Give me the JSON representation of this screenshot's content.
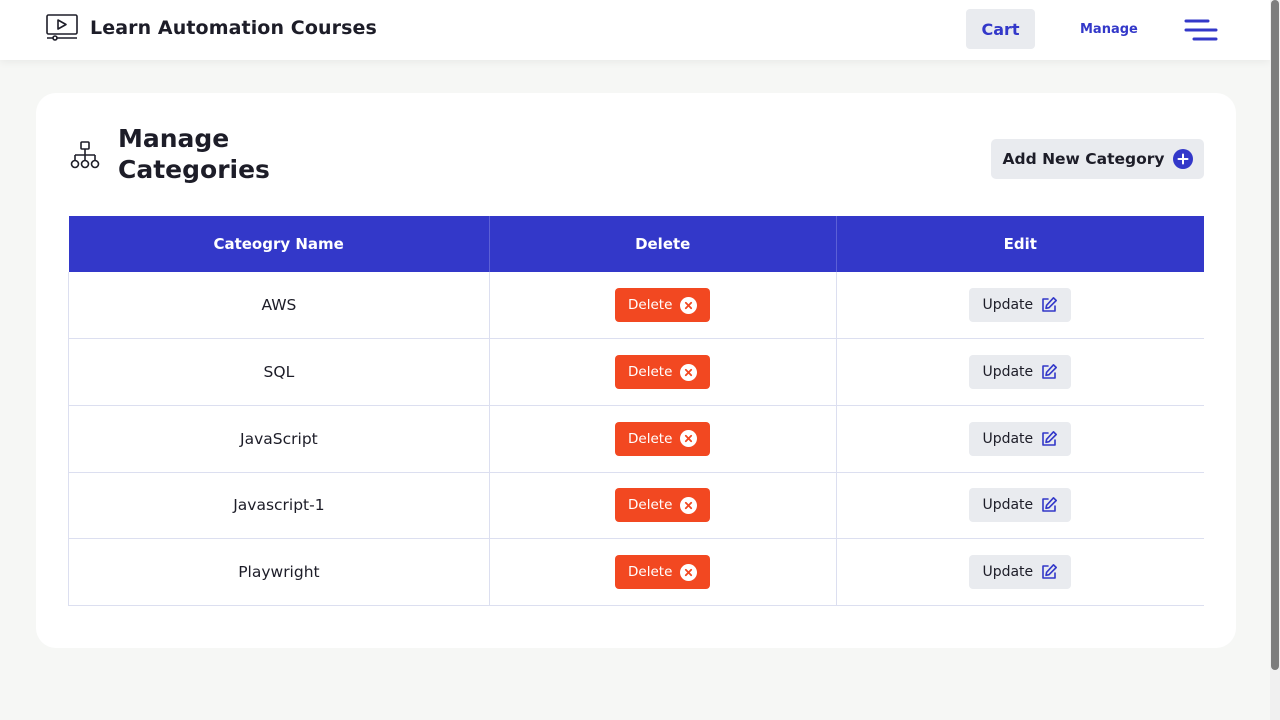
{
  "header": {
    "brand_title": "Learn Automation Courses",
    "brand_icon": "video-screen-icon",
    "cart_label": "Cart",
    "manage_label": "Manage",
    "menu_icon": "hamburger-menu-icon"
  },
  "page": {
    "title": "Manage Categories",
    "title_icon": "hierarchy-icon",
    "add_button_label": "Add New Category",
    "add_button_icon": "plus-circle-icon"
  },
  "table": {
    "columns": [
      "Cateogry Name",
      "Delete",
      "Edit"
    ],
    "rows": [
      {
        "name": "AWS",
        "delete_label": "Delete",
        "update_label": "Update"
      },
      {
        "name": "SQL",
        "delete_label": "Delete",
        "update_label": "Update"
      },
      {
        "name": "JavaScript",
        "delete_label": "Delete",
        "update_label": "Update"
      },
      {
        "name": "Javascript-1",
        "delete_label": "Delete",
        "update_label": "Update"
      },
      {
        "name": "Playwright",
        "delete_label": "Delete",
        "update_label": "Update"
      }
    ]
  },
  "colors": {
    "accent": "#3338c9",
    "delete": "#f24821",
    "button_bg": "#e9ebef",
    "page_bg": "#f6f7f5"
  }
}
